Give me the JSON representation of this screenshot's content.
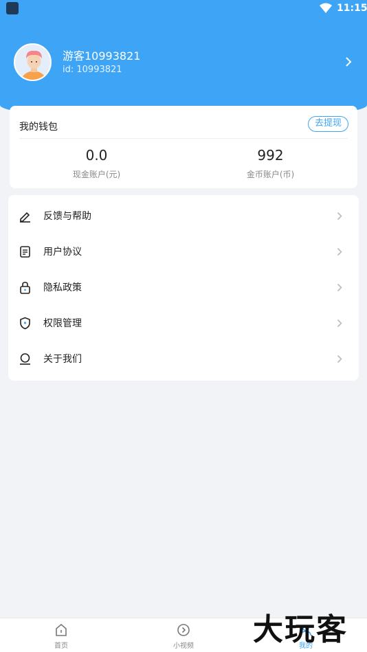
{
  "status": {
    "time": "11:15"
  },
  "profile": {
    "name": "游客10993821",
    "id": "id: 10993821"
  },
  "wallet": {
    "title": "我的钱包",
    "withdraw_label": "去提现",
    "cash_value": "0.0",
    "cash_label": "现金账户(元)",
    "coin_value": "992",
    "coin_label": "金币账户(币)"
  },
  "menu": {
    "items": [
      {
        "label": "反馈与帮助",
        "icon": "edit-icon"
      },
      {
        "label": "用户协议",
        "icon": "document-icon"
      },
      {
        "label": "隐私政策",
        "icon": "lock-icon"
      },
      {
        "label": "权限管理",
        "icon": "shield-icon"
      },
      {
        "label": "关于我们",
        "icon": "user-icon"
      }
    ]
  },
  "nav": {
    "items": [
      {
        "label": "首页",
        "icon": "home-icon"
      },
      {
        "label": "小视频",
        "icon": "play-circle-icon"
      },
      {
        "label": "我的",
        "icon": "user-icon",
        "active": true
      }
    ]
  },
  "watermark": "大玩客",
  "colors": {
    "accent": "#3ea5f6",
    "background": "#f1f3f7"
  }
}
